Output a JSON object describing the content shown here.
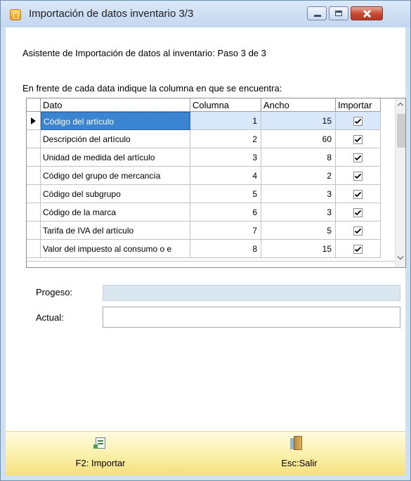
{
  "window": {
    "title": "Importación de datos inventario 3/3"
  },
  "heading": "Asistente de Importación de datos al inventario: Paso 3 de 3",
  "instruction": "En frente de cada data indique la columna en que se encuentra:",
  "grid": {
    "columns": [
      "Dato",
      "Columna",
      "Ancho",
      "Importar"
    ],
    "rows": [
      {
        "dato": "Código del artículo",
        "columna": "1",
        "ancho": "15",
        "importar": true
      },
      {
        "dato": "Descripción del artículo",
        "columna": "2",
        "ancho": "60",
        "importar": true
      },
      {
        "dato": "Unidad de medida del artículo",
        "columna": "3",
        "ancho": "8",
        "importar": true
      },
      {
        "dato": "Código del grupo de mercancía",
        "columna": "4",
        "ancho": "2",
        "importar": true
      },
      {
        "dato": "Código del subgrupo",
        "columna": "5",
        "ancho": "3",
        "importar": true
      },
      {
        "dato": "Código de la marca",
        "columna": "6",
        "ancho": "3",
        "importar": true
      },
      {
        "dato": "Tarifa de IVA del artículo",
        "columna": "7",
        "ancho": "5",
        "importar": true
      },
      {
        "dato": "Valor del impuesto al consumo o e",
        "columna": "8",
        "ancho": "15",
        "importar": true
      }
    ],
    "selected_row": 0
  },
  "progress": {
    "label": "Progeso:",
    "value": 0
  },
  "actual": {
    "label": "Actual:",
    "value": ""
  },
  "footer": {
    "import_button": {
      "label": "F2: Importar",
      "icon": "import-icon"
    },
    "exit_button": {
      "label": "Esc:Salir",
      "icon": "exit-door-icon"
    }
  },
  "colors": {
    "selection": "#3a84d2",
    "selected_row_bg": "#dae8fb",
    "footer_bg": "#fbf0a9",
    "progress_track": "#d9e7f0"
  }
}
